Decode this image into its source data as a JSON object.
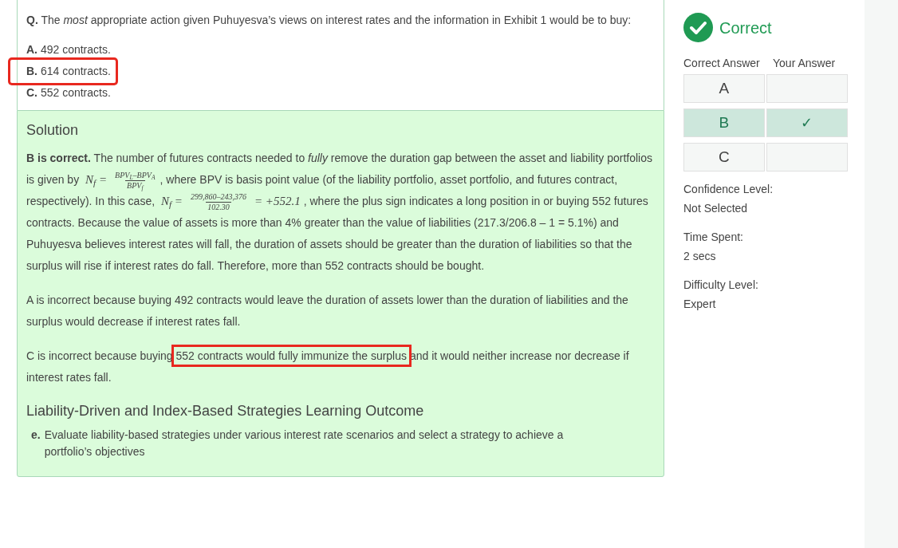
{
  "question": {
    "label": "Q.",
    "text": "The *most* appropriate action given Puhuyesva’s views on interest rates and the information in Exhibit 1 would be to buy:",
    "options": [
      {
        "letter": "A.",
        "text": "492 contracts.",
        "highlighted": false
      },
      {
        "letter": "B.",
        "text": "614 contracts.",
        "highlighted": true
      },
      {
        "letter": "C.",
        "text": "552 contracts.",
        "highlighted": false
      }
    ]
  },
  "solution": {
    "title": "Solution",
    "paragraphs": [
      {
        "segments": [
          {
            "kind": "text",
            "text": "**B is correct.** The number of futures contracts needed to *fully* remove the duration gap between the asset and liability portfolios is given by "
          },
          {
            "kind": "math",
            "text": "N$_{f}$ ="
          },
          {
            "kind": "fraction",
            "numerator": "BPV$_{L}$–BPV$_{A}$",
            "denominator": "BPV$_{f}$"
          },
          {
            "kind": "text",
            "text": ", where BPV is basis point value (of the liability portfolio, asset portfolio, and futures contract, respectively). In this case, "
          },
          {
            "kind": "math",
            "text": "N$_{f}$ ="
          },
          {
            "kind": "fraction",
            "numerator": "299,860–243,376",
            "denominator": "102.30"
          },
          {
            "kind": "math",
            "text": "= +552.1"
          },
          {
            "kind": "text",
            "text": ", where the plus sign indicates a long position in or buying 552 futures contracts. Because the value of assets is more than 4% greater than the value of liabilities (217.3/206.8 – 1 = 5.1%) and Puhuyesva believes interest rates will fall, the duration of assets should be greater than the duration of liabilities so that the surplus will rise if interest rates do fall. Therefore, more than 552 contracts should be bought."
          }
        ]
      },
      {
        "segments": [
          {
            "kind": "text",
            "text": "A is incorrect because buying 492 contracts would leave the duration of assets lower than the duration of liabilities and the surplus would decrease if interest rates fall."
          }
        ]
      },
      {
        "segments": [
          {
            "kind": "text",
            "text": "C is incorrect because buying "
          },
          {
            "kind": "text",
            "text": "552 contracts would fully immunize the surplus",
            "highlighted": true
          },
          {
            "kind": "text",
            "text": " and it would neither increase nor decrease if interest rates fall."
          }
        ]
      }
    ],
    "outcome": {
      "title": "Liability-Driven and Index-Based Strategies Learning Outcome",
      "items": [
        {
          "letter": "e.",
          "text": "Evaluate liability-based strategies under various interest rate scenarios and select a strategy to achieve a portfolio’s objectives"
        }
      ]
    }
  },
  "result": {
    "status": "Correct",
    "correct": true,
    "columns": [
      "Correct Answer",
      "Your Answer"
    ],
    "rows": [
      {
        "letter": "A",
        "correct": false
      },
      {
        "letter": "B",
        "correct": true,
        "your_answer": "✓"
      },
      {
        "letter": "C",
        "correct": false
      }
    ],
    "details": [
      {
        "label": "Confidence Level:",
        "value": "Not Selected"
      },
      {
        "label": "Time Spent:",
        "value": "2 secs"
      },
      {
        "label": "Difficulty Level:",
        "value": "Expert"
      }
    ]
  }
}
